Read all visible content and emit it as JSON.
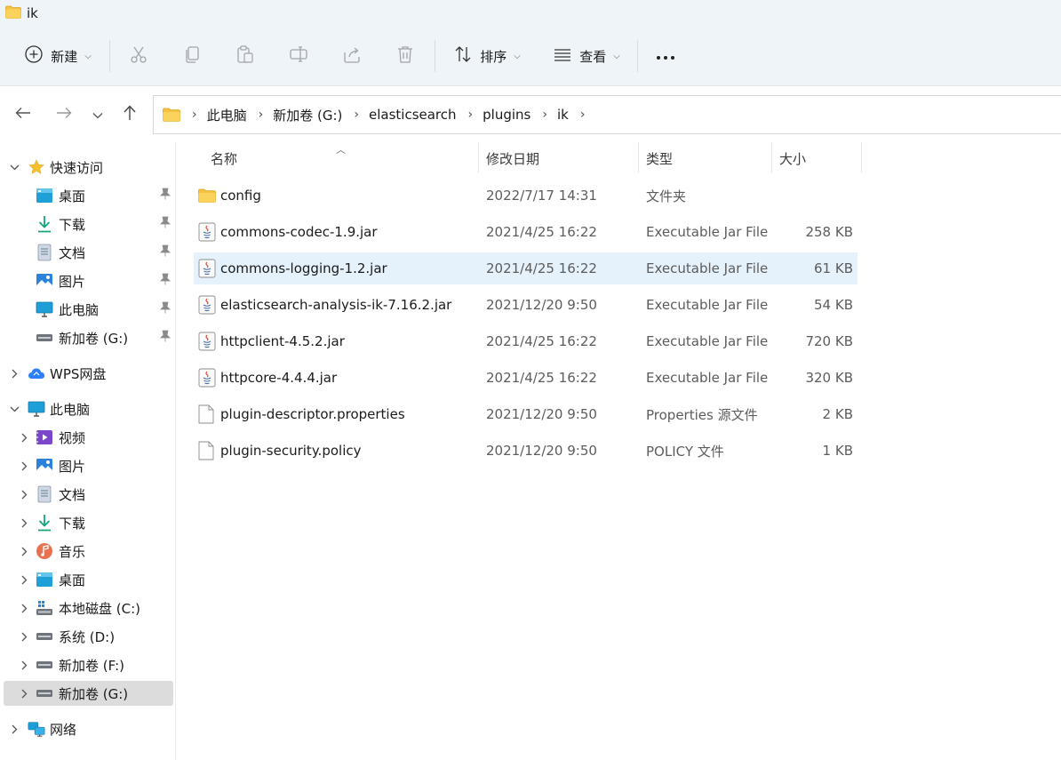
{
  "window": {
    "title": "ik"
  },
  "toolbar": {
    "new_label": "新建",
    "sort_label": "排序",
    "view_label": "查看"
  },
  "address": {
    "crumbs": [
      "此电脑",
      "新加卷 (G:)",
      "elasticsearch",
      "plugins",
      "ik"
    ]
  },
  "sidebar": {
    "quick_access": {
      "label": "快速访问",
      "items": [
        {
          "label": "桌面"
        },
        {
          "label": "下载"
        },
        {
          "label": "文档"
        },
        {
          "label": "图片"
        },
        {
          "label": "此电脑"
        },
        {
          "label": "新加卷 (G:)"
        }
      ]
    },
    "wps": {
      "label": "WPS网盘"
    },
    "this_pc": {
      "label": "此电脑",
      "items": [
        {
          "label": "视频"
        },
        {
          "label": "图片"
        },
        {
          "label": "文档"
        },
        {
          "label": "下载"
        },
        {
          "label": "音乐"
        },
        {
          "label": "桌面"
        },
        {
          "label": "本地磁盘 (C:)"
        },
        {
          "label": "系统 (D:)"
        },
        {
          "label": "新加卷 (F:)"
        },
        {
          "label": "新加卷 (G:)"
        }
      ]
    },
    "network": {
      "label": "网络"
    }
  },
  "columns": {
    "name": "名称",
    "modified": "修改日期",
    "type": "类型",
    "size": "大小"
  },
  "files": [
    {
      "name": "config",
      "modified": "2022/7/17 14:31",
      "type": "文件夹",
      "size": "",
      "icon": "folder-icon"
    },
    {
      "name": "commons-codec-1.9.jar",
      "modified": "2021/4/25 16:22",
      "type": "Executable Jar File",
      "size": "258 KB",
      "icon": "jar-file-icon"
    },
    {
      "name": "commons-logging-1.2.jar",
      "modified": "2021/4/25 16:22",
      "type": "Executable Jar File",
      "size": "61 KB",
      "icon": "jar-file-icon"
    },
    {
      "name": "elasticsearch-analysis-ik-7.16.2.jar",
      "modified": "2021/12/20 9:50",
      "type": "Executable Jar File",
      "size": "54 KB",
      "icon": "jar-file-icon"
    },
    {
      "name": "httpclient-4.5.2.jar",
      "modified": "2021/4/25 16:22",
      "type": "Executable Jar File",
      "size": "720 KB",
      "icon": "jar-file-icon"
    },
    {
      "name": "httpcore-4.4.4.jar",
      "modified": "2021/4/25 16:22",
      "type": "Executable Jar File",
      "size": "320 KB",
      "icon": "jar-file-icon"
    },
    {
      "name": "plugin-descriptor.properties",
      "modified": "2021/12/20 9:50",
      "type": "Properties 源文件",
      "size": "2 KB",
      "icon": "document-icon"
    },
    {
      "name": "plugin-security.policy",
      "modified": "2021/12/20 9:50",
      "type": "POLICY 文件",
      "size": "1 KB",
      "icon": "document-icon"
    }
  ],
  "colors": {
    "accent": "#0067c0",
    "selection": "#e5f1fb",
    "folder": "#f5c242",
    "toolbar_bg": "#eff4f9"
  }
}
